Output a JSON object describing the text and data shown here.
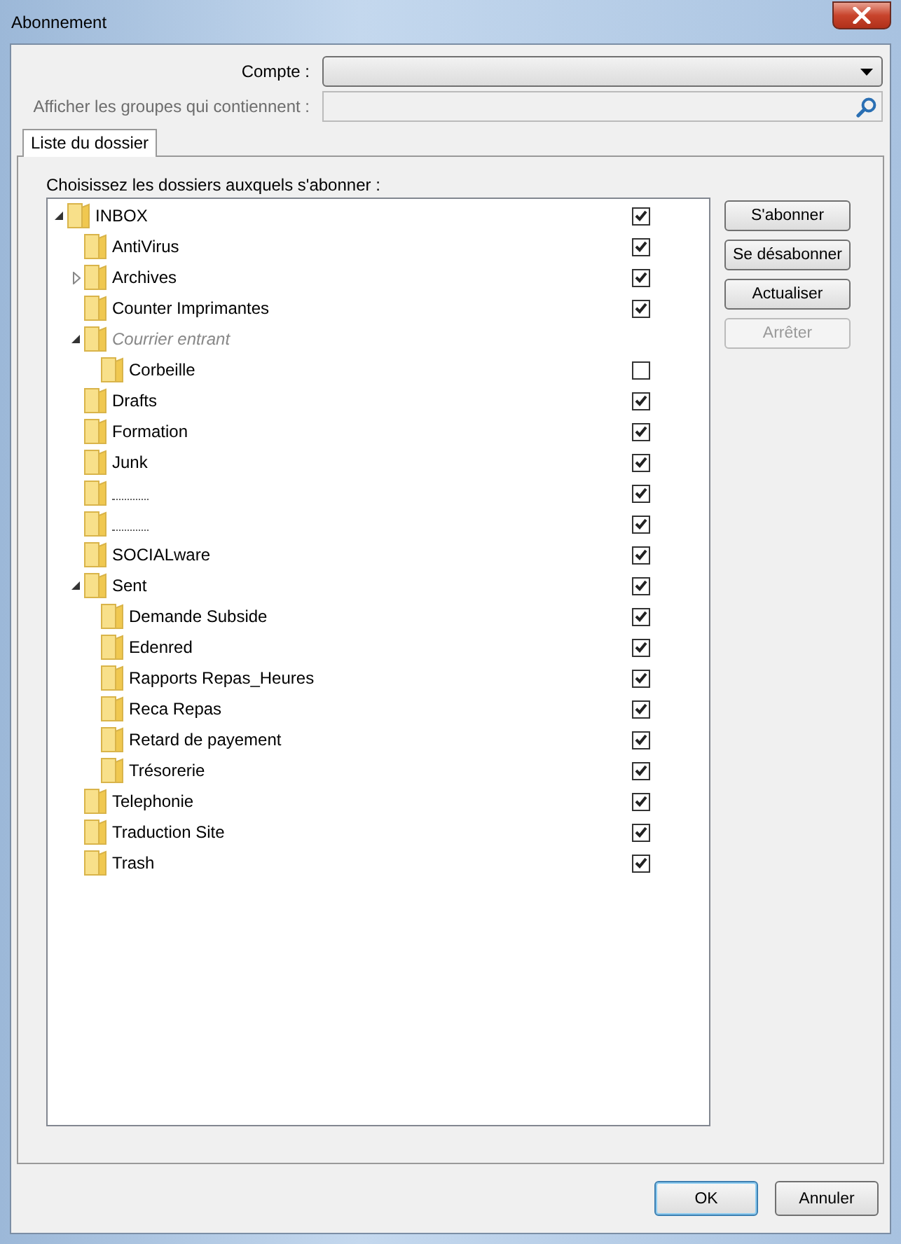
{
  "window": {
    "title": "Abonnement"
  },
  "account": {
    "label": "Compte :"
  },
  "filter": {
    "label": "Afficher les groupes qui contiennent :",
    "disabled": true
  },
  "tabs": [
    {
      "label": "Liste du dossier",
      "selected": true
    }
  ],
  "tree": {
    "heading": "Choisissez les dossiers auxquels s'abonner :",
    "items": [
      {
        "name": "INBOX",
        "expanded": true,
        "checked": true,
        "children": [
          {
            "name": "AntiVirus",
            "checked": true
          },
          {
            "name": "Archives",
            "expanded": false,
            "checked": true
          },
          {
            "name": "Counter Imprimantes",
            "checked": true
          },
          {
            "name": "Courrier entrant",
            "kind": "virtual",
            "expanded": true,
            "children": [
              {
                "name": "Corbeille",
                "checked": false
              }
            ]
          },
          {
            "name": "Drafts",
            "checked": true
          },
          {
            "name": "Formation",
            "checked": true
          },
          {
            "name": "Junk",
            "checked": true
          },
          {
            "kind": "hidden",
            "checked": true
          },
          {
            "kind": "hidden",
            "checked": true
          },
          {
            "name": "SOCIALware",
            "checked": true
          },
          {
            "name": "Sent",
            "expanded": true,
            "checked": true,
            "children": [
              {
                "name": "Demande Subside",
                "checked": true
              },
              {
                "name": "Edenred",
                "checked": true
              },
              {
                "name": "Rapports Repas_Heures",
                "checked": true
              },
              {
                "name": "Reca Repas",
                "checked": true
              },
              {
                "name": "Retard de payement",
                "checked": true
              },
              {
                "name": "Trésorerie",
                "checked": true
              }
            ]
          },
          {
            "name": "Telephonie",
            "checked": true
          },
          {
            "name": "Traduction Site",
            "checked": true
          },
          {
            "name": "Trash",
            "checked": true
          }
        ]
      }
    ]
  },
  "side_buttons": [
    {
      "label": "S'abonner",
      "disabled": false
    },
    {
      "label": "Se désabonner",
      "disabled": false
    },
    {
      "label": "Actualiser",
      "disabled": false
    },
    {
      "label": "Arrêter",
      "disabled": true
    }
  ],
  "buttons": [
    {
      "label": "OK",
      "kind": "default"
    },
    {
      "label": "Annuler",
      "kind": "normal"
    }
  ]
}
